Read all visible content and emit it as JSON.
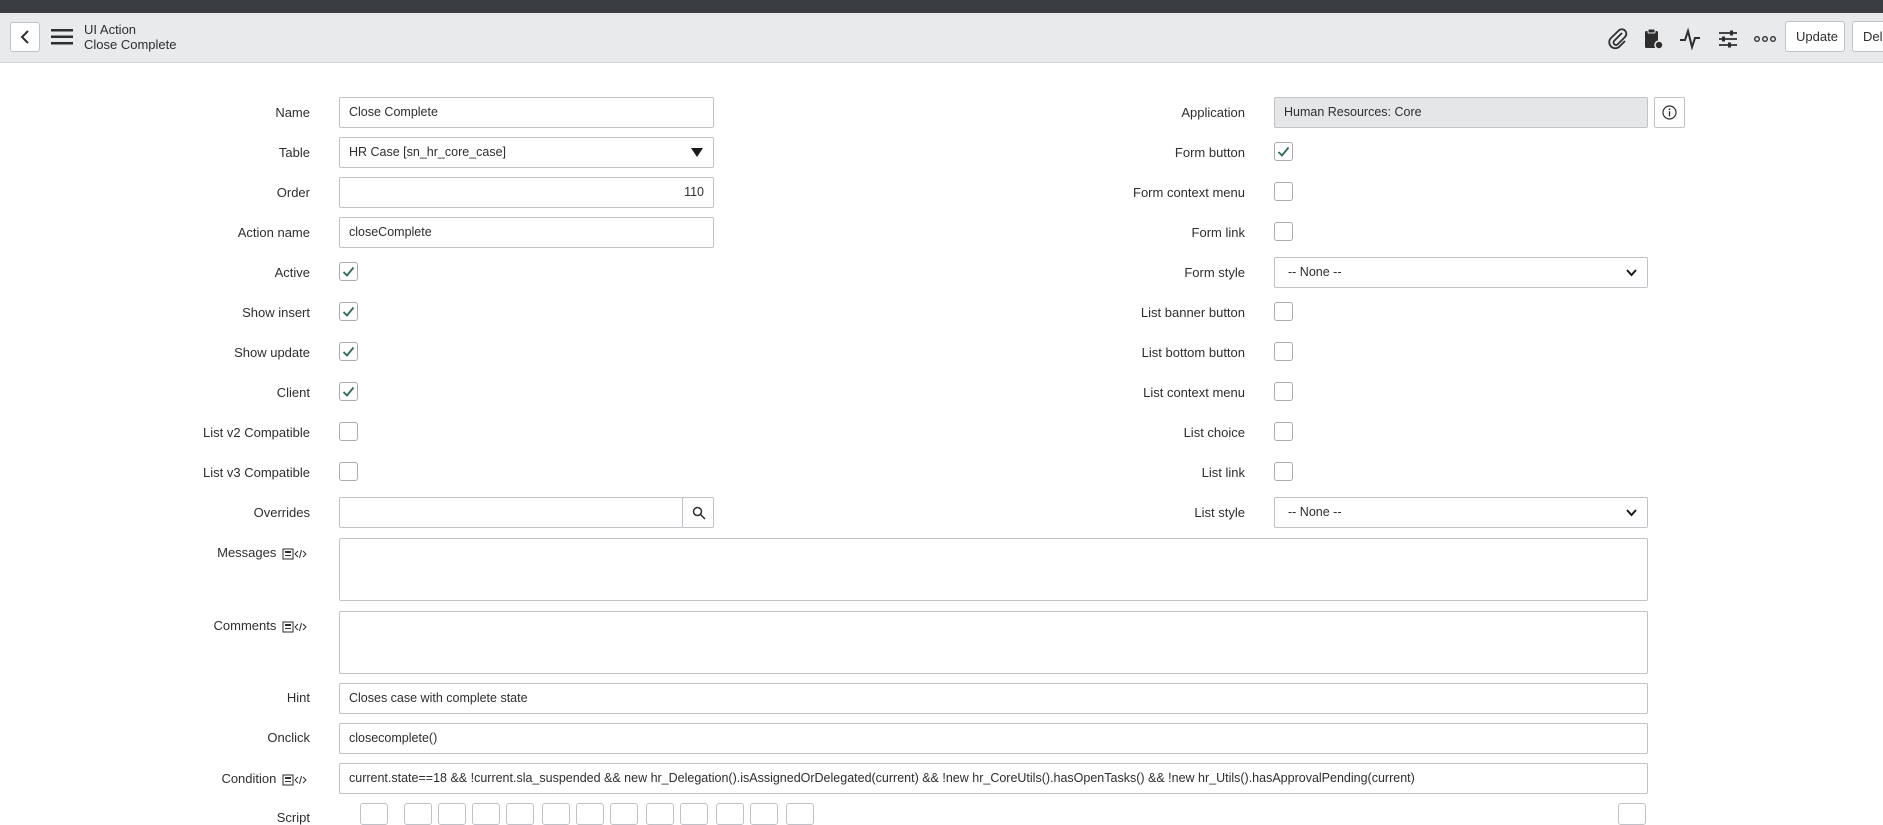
{
  "header": {
    "record_type": "UI Action",
    "record_name": "Close Complete",
    "update_label": "Update",
    "delete_label": "Dele"
  },
  "form": {
    "name": {
      "label": "Name",
      "value": "Close Complete"
    },
    "table": {
      "label": "Table",
      "value": "HR Case [sn_hr_core_case]"
    },
    "order": {
      "label": "Order",
      "value": "110"
    },
    "action_name": {
      "label": "Action name",
      "value": "closeComplete"
    },
    "active": {
      "label": "Active",
      "checked": true
    },
    "show_insert": {
      "label": "Show insert",
      "checked": true
    },
    "show_update": {
      "label": "Show update",
      "checked": true
    },
    "client": {
      "label": "Client",
      "checked": true
    },
    "list_v2": {
      "label": "List v2 Compatible",
      "checked": false
    },
    "list_v3": {
      "label": "List v3 Compatible",
      "checked": false
    },
    "overrides": {
      "label": "Overrides",
      "value": ""
    },
    "messages": {
      "label": "Messages",
      "value": ""
    },
    "comments": {
      "label": "Comments",
      "value": ""
    },
    "hint": {
      "label": "Hint",
      "value": "Closes case with complete state"
    },
    "onclick": {
      "label": "Onclick",
      "value": "closecomplete()"
    },
    "condition": {
      "label": "Condition",
      "value": "current.state==18 && !current.sla_suspended && new hr_Delegation().isAssignedOrDelegated(current) && !new hr_CoreUtils().hasOpenTasks() && !new hr_Utils().hasApprovalPending(current)"
    },
    "script": {
      "label": "Script"
    },
    "application": {
      "label": "Application",
      "value": "Human Resources: Core"
    },
    "form_button": {
      "label": "Form button",
      "checked": true
    },
    "form_context_menu": {
      "label": "Form context menu",
      "checked": false
    },
    "form_link": {
      "label": "Form link",
      "checked": false
    },
    "form_style": {
      "label": "Form style",
      "value": "-- None --"
    },
    "list_banner_button": {
      "label": "List banner button",
      "checked": false
    },
    "list_bottom_button": {
      "label": "List bottom button",
      "checked": false
    },
    "list_context_menu": {
      "label": "List context menu",
      "checked": false
    },
    "list_choice": {
      "label": "List choice",
      "checked": false
    },
    "list_link": {
      "label": "List link",
      "checked": false
    },
    "list_style": {
      "label": "List style",
      "value": "-- None --"
    }
  },
  "icons": {
    "back": "chevron-left-icon",
    "menu": "hamburger-icon",
    "attach": "paperclip-icon",
    "clipboard": "clipboard-icon",
    "activity": "activity-pulse-icon",
    "settings": "sliders-icon",
    "more": "more-options-icon",
    "info": "info-icon",
    "search": "search-icon",
    "field_code": "script-field-icon"
  },
  "colors": {
    "check": "#2e6a5f",
    "header_bg": "#e9eaec",
    "top_strip": "#3a3d42"
  }
}
